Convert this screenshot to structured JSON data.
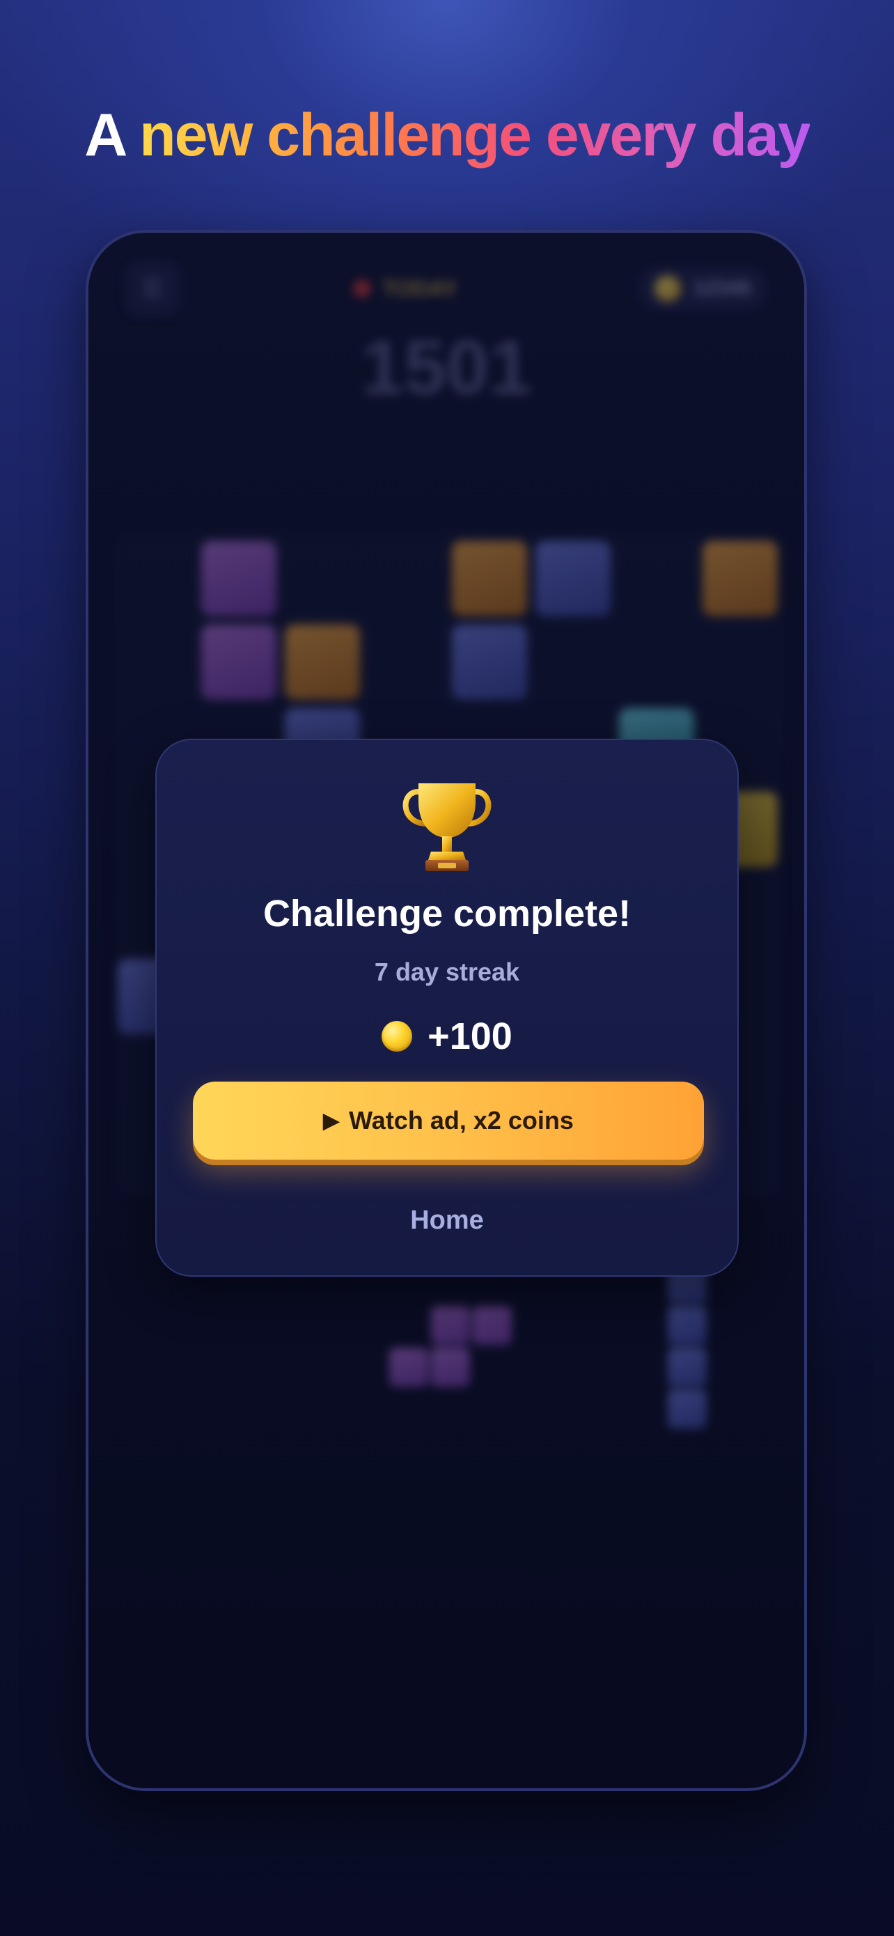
{
  "headline": {
    "first_word": "A",
    "highlight": "new challenge every day"
  },
  "background_game": {
    "target_label": "TODAY",
    "coin_count": "12345",
    "score": "1501",
    "menu_icon": "hamburger-icon"
  },
  "modal": {
    "icon": "trophy-icon",
    "title": "Challenge complete!",
    "subtitle": "7 day streak",
    "reward_amount": "+100",
    "watch_button_icon": "▶",
    "watch_button_label": "Watch ad, x2 coins",
    "home_label": "Home"
  },
  "colors": {
    "accent_gradient_start": "#ffd659",
    "accent_gradient_end": "#ffa235",
    "modal_bg": "#1a1f4d",
    "page_bg_top": "#3f56b8",
    "page_bg_bottom": "#090c24"
  }
}
